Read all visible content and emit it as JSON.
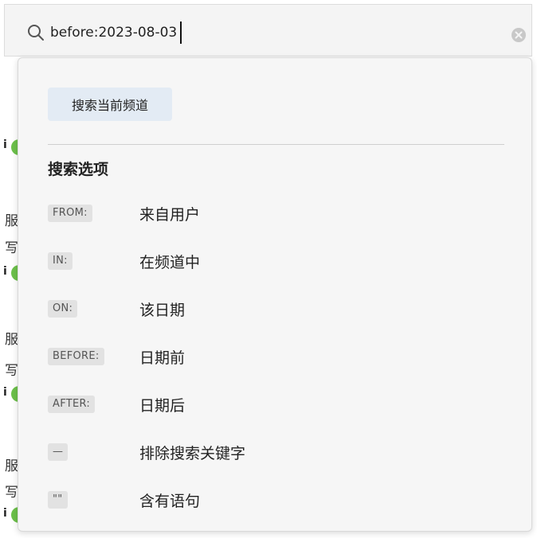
{
  "search": {
    "query": "before:2023-08-03",
    "placeholder": ""
  },
  "dropdown": {
    "channel_button_label": "搜索当前频道",
    "section_title": "搜索选项",
    "options": [
      {
        "tag": "FROM:",
        "label": "来自用户"
      },
      {
        "tag": "IN:",
        "label": "在频道中"
      },
      {
        "tag": "ON:",
        "label": "该日期"
      },
      {
        "tag": "BEFORE:",
        "label": "日期前"
      },
      {
        "tag": "AFTER:",
        "label": "日期后"
      },
      {
        "tag": "—",
        "label": "排除搜索关键字"
      },
      {
        "tag": "\"\"",
        "label": "含有语句"
      }
    ]
  },
  "background_channel": {
    "chars": [
      "服",
      "写",
      "服",
      "写",
      "服",
      "写"
    ]
  },
  "colors": {
    "search_bar_bg": "#f4f4f4",
    "dropdown_bg": "#f6f6f6",
    "channel_button_bg": "#e3ebf4",
    "tag_bg": "#e2e2e2",
    "avatar_green": "#6cc04a"
  },
  "icons": {
    "search": "search-icon",
    "clear": "clear-icon"
  }
}
